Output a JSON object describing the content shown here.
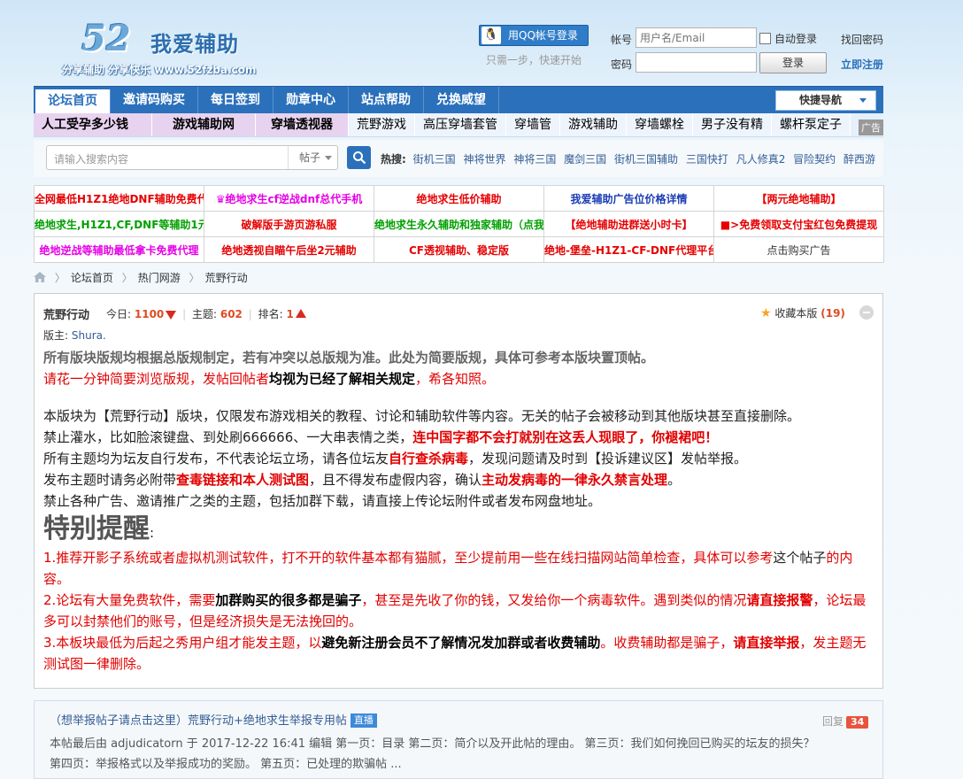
{
  "logo": {
    "number": "52",
    "name": "我爱辅助",
    "slogan": "分享辅助 分享快乐 www.52fzba.com"
  },
  "login": {
    "qq_button": "用QQ帐号登录",
    "qq_tip": "只需一步，快速开始",
    "account_label": "帐号",
    "account_placeholder": "用户名/Email",
    "password_label": "密码",
    "auto_login": "自动登录",
    "login_button": "登录",
    "find_password": "找回密码",
    "register": "立即注册"
  },
  "nav": {
    "items": [
      "论坛首页",
      "邀请码购买",
      "每日签到",
      "勋章中心",
      "站点帮助",
      "兑换威望"
    ],
    "quick_nav": "快捷导航"
  },
  "ads_bar": {
    "items": [
      "人工受孕多少钱",
      "游戏辅助网",
      "穿墙透视器",
      "荒野游戏",
      "高压穿墙套管",
      "穿墙管",
      "游戏辅助",
      "穿墙螺栓",
      "男子没有精",
      "螺杆泵定子"
    ],
    "tag": "广告"
  },
  "search": {
    "placeholder": "请输入搜索内容",
    "type": "帖子",
    "hot_label": "热搜:",
    "hot": [
      "街机三国",
      "神将世界",
      "神将三国",
      "魔剑三国",
      "街机三国辅助",
      "三国快打",
      "凡人修真2",
      "冒险契约",
      "醉西游"
    ]
  },
  "ad_table": {
    "rows": [
      [
        {
          "t": "全网最低H1Z1绝地DNF辅助免费代",
          "c": "#e60000"
        },
        {
          "t": "♛绝地求生cf逆战dnf总代手机",
          "c": "#e600e6"
        },
        {
          "t": "绝地求生低价辅助",
          "c": "#e60000"
        },
        {
          "t": "我爱辅助广告位价格详情",
          "c": "#1a3cb4"
        },
        {
          "t": "【两元绝地辅助】",
          "c": "#e60000"
        }
      ],
      [
        {
          "t": "绝地求生,H1Z1,CF,DNF等辅助1元",
          "c": "#00a000"
        },
        {
          "t": "破解版手游页游私服",
          "c": "#e60000"
        },
        {
          "t": "绝地求生永久辅助和独家辅助（点我",
          "c": "#00a000"
        },
        {
          "t": "【绝地辅助进群送小时卡】",
          "c": "#e60000"
        },
        {
          "t": "■>免费领取支付宝红包免费提现",
          "c": "#e60000"
        }
      ],
      [
        {
          "t": "绝地逆战等辅助最低拿卡免费代理",
          "c": "#e600e6"
        },
        {
          "t": "绝地透视自瞄午后坐2元辅助",
          "c": "#e60000"
        },
        {
          "t": "CF透视辅助、稳定版",
          "c": "#e60000"
        },
        {
          "t": "绝地-堡垒-H1Z1-CF-DNF代理平台",
          "c": "#e60000"
        },
        {
          "t": "点击购买广告",
          "c": "#333333"
        }
      ]
    ]
  },
  "breadcrumb": [
    "论坛首页",
    "热门网游",
    "荒野行动"
  ],
  "board": {
    "title": "荒野行动",
    "today_label": "今日:",
    "today": "1100",
    "topics_label": "主题:",
    "topics": "602",
    "rank_label": "排名:",
    "rank": "1",
    "fav_label": "收藏本版",
    "fav_count": "(19)",
    "moderator_label": "版主:",
    "moderator": "Shura."
  },
  "rules": {
    "l1": "所有版块版规均根据总版规制定，若有冲突以总版规为准。此处为简要版规，具体可参考本版块置顶帖。",
    "l2a": "请花一分钟简要浏览版规，发帖回帖者",
    "l2b": "均视为已经了解相关规定",
    "l2c": "，希各知照。",
    "l3": "本版块为【荒野行动】版块，仅限发布游戏相关的教程、讨论和辅助软件等内容。无关的帖子会被移动到其他版块甚至直接删除。",
    "l4a": "禁止灌水，比如脸滚键盘、到处刷666666、一大串表情之类，",
    "l4b": "连中国字都不会打就别在这丢人现眼了，你褪裙吧！",
    "l5a": "所有主题均为坛友自行发布，不代表论坛立场，请各位坛友",
    "l5b": "自行查杀病毒",
    "l5c": "，发现问题请及时到【投诉建议区】发帖举报。",
    "l6a": "发布主题时请务必附带",
    "l6b": "查毒链接和本人测试图",
    "l6c": "，且不得发布虚假内容，确认",
    "l6d": "主动发病毒的一律永久禁言处理",
    "l6e": "。",
    "l7": "禁止各种广告、邀请推广之类的主题，包括加群下载，请直接上传论坛附件或者发布网盘地址。",
    "special": "特别提醒",
    "colon": ":",
    "p1a": "1.推荐开影子系统或者虚拟机测试软件，打不开的软件基本都有猫腻，至少提前用一些在线扫描网站简单检查，具体可以参考",
    "p1b": "这个帖子",
    "p1c": "的内容。",
    "p2a": "2.论坛有大量免费软件，需要",
    "p2b": "加群购买的很多都是骗子",
    "p2c": "，甚至是先收了你的钱，又发给你一个病毒软件。遇到类似的情况",
    "p2d": "请直接报警",
    "p2e": "，论坛最多可以封禁他们的账号，但是经济损失是无法挽回的。",
    "p3a": "3.本板块最低为后起之秀用户组才能发主题，以",
    "p3b": "避免新注册会员不了解情况发加群或者收费辅助",
    "p3c": "。收费辅助都是骗子，",
    "p3d": "请直接举报",
    "p3e": "，发主题无测试图一律删除。"
  },
  "thread": {
    "title": "（想举报帖子请点击这里）荒野行动+绝地求生举报专用帖",
    "badge": "直播",
    "reply_label": "回复",
    "reply_count": "34",
    "summary": "本帖最后由 adjudicatorn 于 2017-12-22 16:41 编辑 第一页：目录 第二页：简介以及开此帖的理由。 第三页：我们如何挽回已购买的坛友的损失？ 第四页：举报格式以及举报成功的奖励。 第五页：已处理的欺骗帖 ..."
  },
  "icons": {
    "qq": "qq-penguin-icon",
    "search": "search-icon",
    "home": "home-icon",
    "star": "star-icon"
  },
  "colors": {
    "nav_blue": "#2b70bb",
    "alert_red": "#e20000",
    "link_blue": "#335d94"
  }
}
